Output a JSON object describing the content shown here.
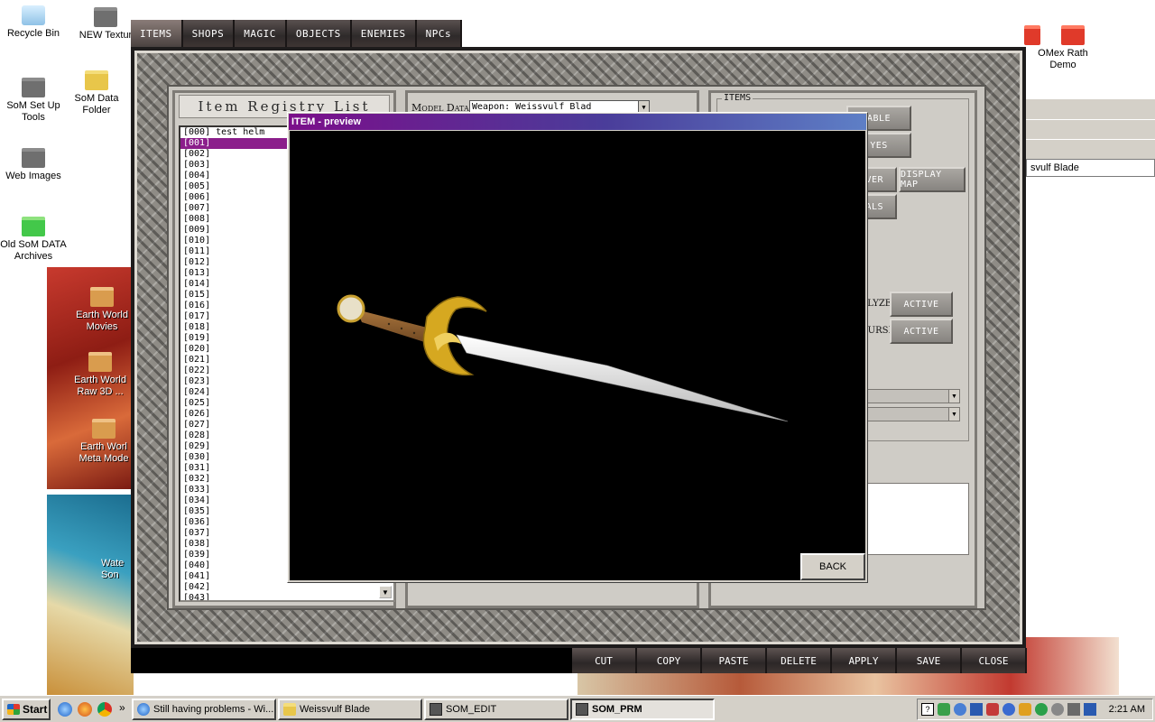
{
  "desktop": {
    "icons": [
      {
        "label": "Recycle Bin"
      },
      {
        "label": "NEW Textur"
      },
      {
        "label": "SoM Set Up Tools"
      },
      {
        "label": "SoM Data Folder"
      },
      {
        "label": "Web Images"
      },
      {
        "label": "Old SoM DATA Archives"
      },
      {
        "label": "Earth World Movies"
      },
      {
        "label": "Earth World Raw 3D ..."
      },
      {
        "label": "Earth Worl Meta Mode"
      },
      {
        "label": "Wate Son"
      },
      {
        "label": "OMex Rath Demo"
      }
    ],
    "side_window_address": "svulf Blade"
  },
  "som_edit": {
    "tabs": [
      "ITEMS",
      "SHOPS",
      "MAGIC",
      "OBJECTS",
      "ENEMIES",
      "NPCs"
    ],
    "active_tab": "ITEMS",
    "registry": {
      "title": "Item Registry List",
      "rows": [
        "[000] test helm",
        "[001]",
        "[002]",
        "[003]",
        "[004]",
        "[005]",
        "[006]",
        "[007]",
        "[008]",
        "[009]",
        "[010]",
        "[011]",
        "[012]",
        "[013]",
        "[014]",
        "[015]",
        "[016]",
        "[017]",
        "[018]",
        "[019]",
        "[020]",
        "[021]",
        "[022]",
        "[023]",
        "[024]",
        "[025]",
        "[026]",
        "[027]",
        "[028]",
        "[029]",
        "[030]",
        "[031]",
        "[032]",
        "[033]",
        "[034]",
        "[035]",
        "[036]",
        "[037]",
        "[038]",
        "[039]",
        "[040]",
        "[041]",
        "[042]",
        "[043]"
      ],
      "selected_index": 1
    },
    "model": {
      "label": "Model Data",
      "selected_value": "Weapon: Weissvulf Blad"
    },
    "items_panel": {
      "group_label": "ITEMS",
      "buttons": {
        "able": "ABLE",
        "yes": "YES",
        "over": "OVER",
        "display_map": "DISPLAY MAP",
        "eals": "EALS",
        "active_1": "ACTIVE",
        "active_2": "ACTIVE"
      },
      "status_labels": {
        "analyze": "ALYZE",
        "curse": "CURSE"
      }
    },
    "bottom_buttons": [
      "CUT",
      "COPY",
      "PASTE",
      "DELETE",
      "APPLY",
      "SAVE",
      "CLOSE"
    ]
  },
  "preview_dialog": {
    "title": "ITEM - preview",
    "back_label": "BACK"
  },
  "taskbar": {
    "start_label": "Start",
    "overflow": "»",
    "tasks": [
      {
        "label": "Still having problems - Wi...",
        "active": false
      },
      {
        "label": "Weissvulf Blade",
        "active": false
      },
      {
        "label": "SOM_EDIT",
        "active": false
      },
      {
        "label": "SOM_PRM",
        "active": true
      }
    ],
    "clock": "2:21 AM"
  }
}
